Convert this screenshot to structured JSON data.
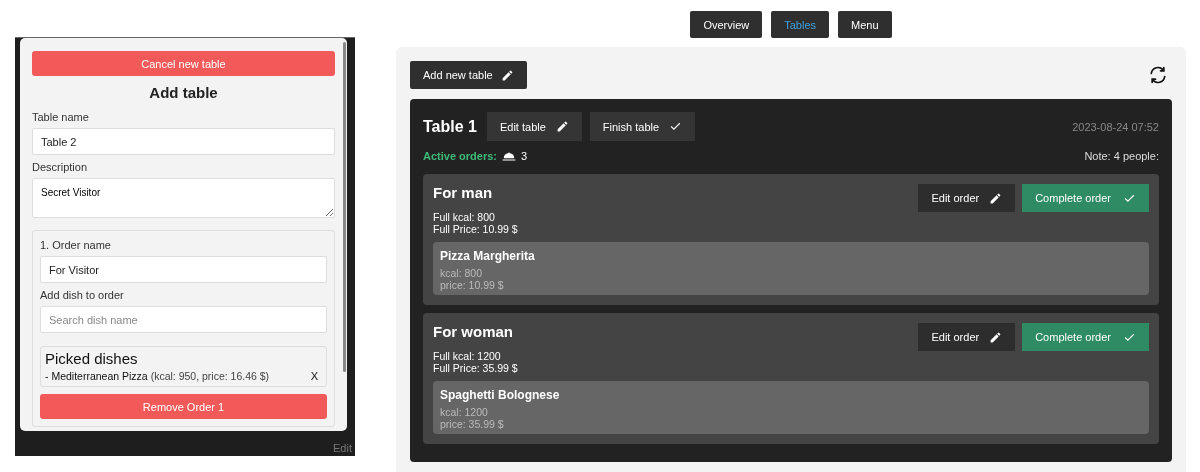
{
  "modal": {
    "cancel_button": "Cancel new table",
    "title": "Add table",
    "table_name": {
      "label": "Table name",
      "value": "Table 2"
    },
    "description": {
      "label": "Description",
      "value": "Secret Visitor"
    },
    "orders": [
      {
        "label": "1. Order name",
        "value": "For Visitor",
        "dish_label": "Add dish to order",
        "dish_placeholder": "Search dish name",
        "picked_title": "Picked dishes",
        "picked": [
          {
            "name": "- Mediterranean Pizza",
            "details": "(kcal: 950, price: 16.46 $)",
            "remove": "X"
          }
        ],
        "remove_button": "Remove Order 1"
      }
    ]
  },
  "background_text": "Edit",
  "nav": [
    {
      "label": "Overview",
      "selected": false
    },
    {
      "label": "Tables",
      "selected": true
    },
    {
      "label": "Menu",
      "selected": false
    }
  ],
  "add_button": "Add new table",
  "tables": [
    {
      "name": "Table 1",
      "edit_button": "Edit table",
      "finish_button": "Finish table",
      "date": "2023-08-24 07:52",
      "active_label": "Active orders:",
      "active_count": "3",
      "note": "Note: 4 people:",
      "orders": [
        {
          "name": "For man",
          "kcal": "Full kcal: 800",
          "price": "Full Price: 10.99 $",
          "edit_button": "Edit order",
          "complete_button": "Complete order",
          "dishes": [
            {
              "name": "Pizza Margherita",
              "kcal": "kcal: 800",
              "price": "price: 10.99 $"
            }
          ]
        },
        {
          "name": "For woman",
          "kcal": "Full kcal: 1200",
          "price": "Full Price: 35.99 $",
          "edit_button": "Edit order",
          "complete_button": "Complete order",
          "dishes": [
            {
              "name": "Spaghetti Bolognese",
              "kcal": "kcal: 1200",
              "price": "price: 35.99 $"
            }
          ]
        }
      ]
    }
  ]
}
